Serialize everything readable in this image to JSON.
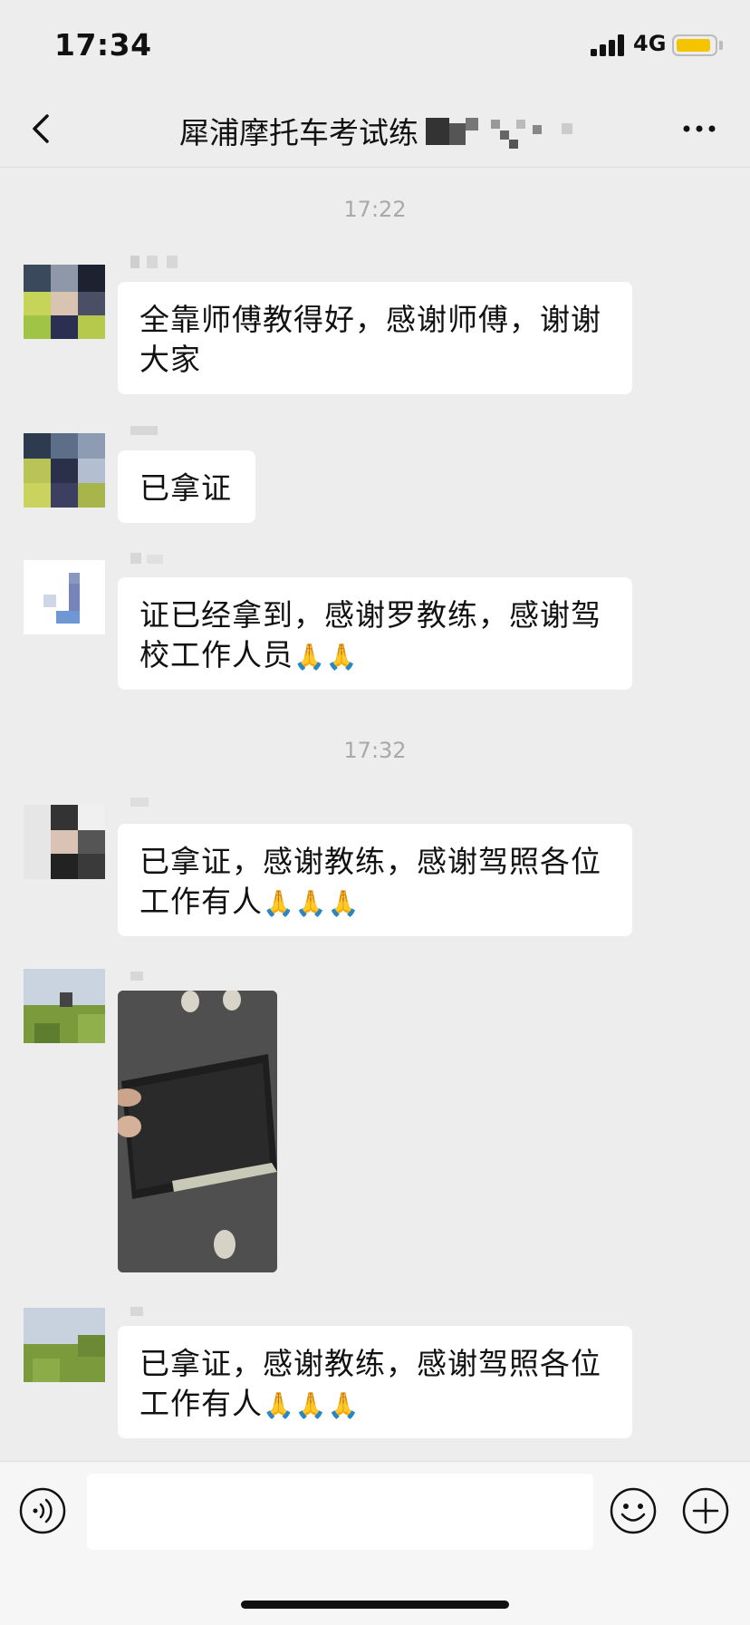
{
  "status": {
    "time": "17:34",
    "network": "4G"
  },
  "header": {
    "title": "犀浦摩托车考试练",
    "back_icon": "chevron-left-icon",
    "more_icon": "more-dots-icon"
  },
  "time_separators": [
    "17:22",
    "17:32"
  ],
  "messages": [
    {
      "text": "全靠师傅教得好，感谢师傅，谢谢大家"
    },
    {
      "text": "已拿证"
    },
    {
      "text": "证已经拿到，感谢罗教练，感谢驾校工作人员",
      "emoji": "🙏🙏"
    },
    {
      "text": "已拿证，感谢教练，感谢驾照各位工作有人",
      "emoji": "🙏🙏🙏"
    },
    {
      "type": "image",
      "icon": "photo-license-image"
    },
    {
      "text": "已拿证，感谢教练，感谢驾照各位工作有人",
      "emoji": "🙏🙏🙏"
    }
  ],
  "input_bar": {
    "voice_icon": "voice-icon",
    "emoji_icon": "emoji-icon",
    "plus_icon": "plus-icon"
  },
  "colors": {
    "background": "#ededed",
    "bubble": "#ffffff",
    "battery": "#f5c400"
  }
}
